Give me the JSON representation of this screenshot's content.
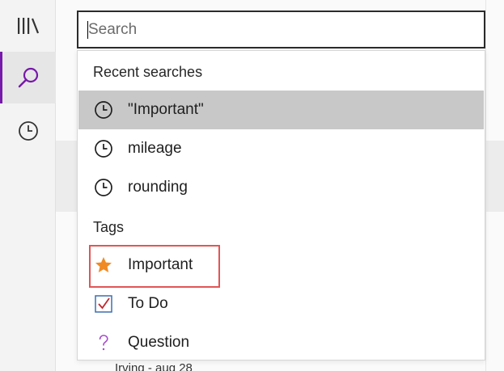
{
  "search": {
    "placeholder": "Search",
    "value": ""
  },
  "rail": {
    "items": [
      {
        "name": "notebooks",
        "icon": "library-icon"
      },
      {
        "name": "search",
        "icon": "magnifier-icon",
        "active": true
      },
      {
        "name": "recent",
        "icon": "clock-icon"
      }
    ]
  },
  "dropdown": {
    "recent_header": "Recent searches",
    "recent": [
      {
        "label": "\"Important\"",
        "icon": "clock-icon",
        "selected": true
      },
      {
        "label": "mileage",
        "icon": "clock-icon"
      },
      {
        "label": "rounding",
        "icon": "clock-icon"
      }
    ],
    "tags_header": "Tags",
    "tags": [
      {
        "label": "Important",
        "icon": "star-icon"
      },
      {
        "label": "To Do",
        "icon": "checkbox-icon"
      },
      {
        "label": "Question",
        "icon": "question-icon"
      }
    ]
  },
  "background": {
    "partial_text": "Irving - aug 28"
  },
  "colors": {
    "accent": "#7719aa",
    "selected_row": "#c8c8c8",
    "star": "#f08a24",
    "check": "#c1272d",
    "question": "#a64ac9",
    "highlight": "#e25555"
  }
}
